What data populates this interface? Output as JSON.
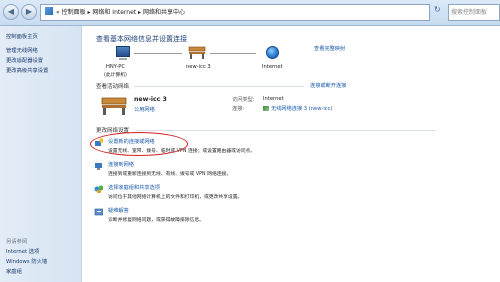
{
  "address_bar": {
    "back_icon": "back-arrow-icon",
    "forward_icon": "forward-arrow-icon",
    "path": "« 控制面板 ▸ 网络和 Internet ▸ 网络和共享中心",
    "search_placeholder": "搜索控制面板"
  },
  "sidebar": {
    "items": [
      {
        "label": "控制面板主页"
      },
      {
        "label": "管理无线网络"
      },
      {
        "label": "更改适配器设置"
      },
      {
        "label": "更改高级共享设置"
      }
    ],
    "see_also_heading": "另请参阅",
    "see_also_items": [
      {
        "label": "Internet 选项"
      },
      {
        "label": "Windows 防火墙"
      },
      {
        "label": "家庭组"
      }
    ]
  },
  "main": {
    "title": "查看基本网络信息并设置连接",
    "see_full_map": "查看完整映射",
    "map": {
      "computer_label": "HNY-PC",
      "computer_sub": "(此计算机)",
      "network_label": "new-icc  3",
      "internet_label": "Internet"
    },
    "active_networks_heading": "查看活动网络",
    "connect_disconnect": "连接或断开连接",
    "network": {
      "name": "new-icc  3",
      "type": "公用网络",
      "access_type_label": "访问类型:",
      "access_type_value": "Internet",
      "connections_label": "连接:",
      "connections_value": "无线网络连接 3 (new-icc)"
    },
    "change_settings_heading": "更改网络设置",
    "tasks": [
      {
        "title": "设置新的连接或网络",
        "desc": "设置无线、宽带、拨号、临时或 VPN 连接；或设置路由器或访问点。",
        "icon": "new-connection-icon"
      },
      {
        "title": "连接到网络",
        "desc": "连接到或重新连接到无线、有线、拨号或 VPN 网络连接。",
        "icon": "connect-network-icon"
      },
      {
        "title": "选择家庭组和共享选项",
        "desc": "访问位于其他网络计算机上的文件和打印机，或更改共享设置。",
        "icon": "homegroup-icon"
      },
      {
        "title": "疑难解答",
        "desc": "诊断并修复网络问题，或获得故障排除信息。",
        "icon": "troubleshoot-icon"
      }
    ]
  },
  "colors": {
    "link": "#1a5aa8",
    "title": "#1e3f7a",
    "highlight_oval": "#d42020"
  }
}
